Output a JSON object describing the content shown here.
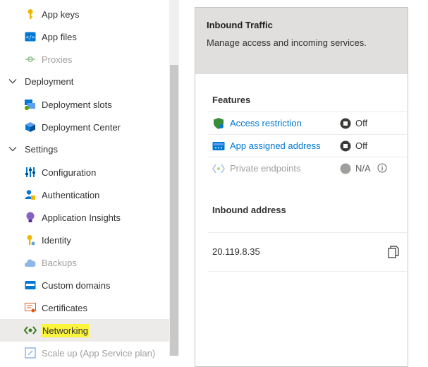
{
  "sidebar": {
    "items": [
      {
        "label": "App keys",
        "icon": "key-icon",
        "kind": "child",
        "disabled": false,
        "selected": false
      },
      {
        "label": "App files",
        "icon": "code-file-icon",
        "kind": "child",
        "disabled": false,
        "selected": false
      },
      {
        "label": "Proxies",
        "icon": "proxy-icon",
        "kind": "child",
        "disabled": true,
        "selected": false
      },
      {
        "label": "Deployment",
        "icon": "chevron-down-icon",
        "kind": "group",
        "disabled": false,
        "selected": false
      },
      {
        "label": "Deployment slots",
        "icon": "slots-icon",
        "kind": "child",
        "disabled": false,
        "selected": false
      },
      {
        "label": "Deployment Center",
        "icon": "cube-icon",
        "kind": "child",
        "disabled": false,
        "selected": false
      },
      {
        "label": "Settings",
        "icon": "chevron-down-icon",
        "kind": "group",
        "disabled": false,
        "selected": false
      },
      {
        "label": "Configuration",
        "icon": "sliders-icon",
        "kind": "child",
        "disabled": false,
        "selected": false
      },
      {
        "label": "Authentication",
        "icon": "user-lock-icon",
        "kind": "child",
        "disabled": false,
        "selected": false
      },
      {
        "label": "Application Insights",
        "icon": "lightbulb-icon",
        "kind": "child",
        "disabled": false,
        "selected": false
      },
      {
        "label": "Identity",
        "icon": "identity-key-icon",
        "kind": "child",
        "disabled": false,
        "selected": false
      },
      {
        "label": "Backups",
        "icon": "cloud-icon",
        "kind": "child",
        "disabled": true,
        "selected": false
      },
      {
        "label": "Custom domains",
        "icon": "domain-icon",
        "kind": "child",
        "disabled": false,
        "selected": false
      },
      {
        "label": "Certificates",
        "icon": "certificate-icon",
        "kind": "child",
        "disabled": false,
        "selected": false
      },
      {
        "label": "Networking",
        "icon": "networking-icon",
        "kind": "child",
        "disabled": false,
        "selected": true
      },
      {
        "label": "Scale up (App Service plan)",
        "icon": "scale-up-icon",
        "kind": "child",
        "disabled": true,
        "selected": false
      }
    ]
  },
  "card": {
    "title": "Inbound Traffic",
    "description": "Manage access and incoming services.",
    "features_title": "Features",
    "features": [
      {
        "label": "Access restriction",
        "icon": "shield-icon",
        "status": "Off",
        "status_icon": "stop-circle-icon",
        "disabled": false
      },
      {
        "label": "App assigned address",
        "icon": "ip-address-icon",
        "status": "Off",
        "status_icon": "stop-circle-icon",
        "disabled": false
      },
      {
        "label": "Private endpoints",
        "icon": "private-endpoint-icon",
        "status": "N/A",
        "status_icon": "gray-circle-icon",
        "disabled": true,
        "has_info": true
      }
    ],
    "inbound_title": "Inbound address",
    "inbound_address": "20.119.8.35"
  },
  "colors": {
    "link": "#0078d4",
    "highlight": "#fbf43c",
    "header_bg": "#e1dfdd"
  }
}
